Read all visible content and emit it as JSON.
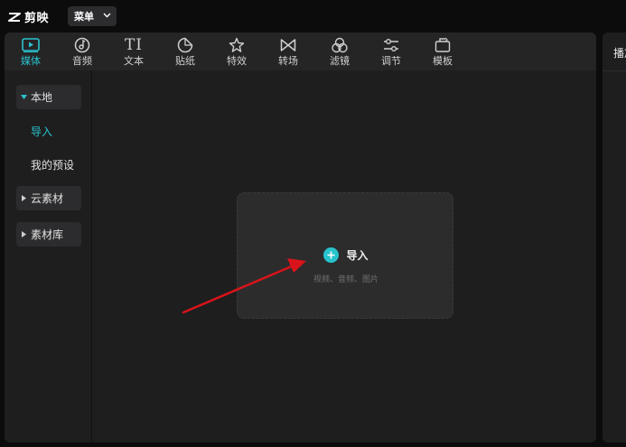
{
  "app": {
    "name": "剪映",
    "menu_label": "菜单"
  },
  "toolbar": {
    "items": [
      {
        "label": "媒体",
        "icon": "media-icon",
        "active": true
      },
      {
        "label": "音频",
        "icon": "audio-icon",
        "active": false
      },
      {
        "label": "文本",
        "icon": "text-icon",
        "active": false
      },
      {
        "label": "贴纸",
        "icon": "sticker-icon",
        "active": false
      },
      {
        "label": "特效",
        "icon": "effects-icon",
        "active": false
      },
      {
        "label": "转场",
        "icon": "transition-icon",
        "active": false
      },
      {
        "label": "滤镜",
        "icon": "filter-icon",
        "active": false
      },
      {
        "label": "调节",
        "icon": "adjust-icon",
        "active": false
      },
      {
        "label": "模板",
        "icon": "template-icon",
        "active": false
      }
    ],
    "text_icon_glyph": "TI"
  },
  "sidebar": {
    "local": "本地",
    "import": "导入",
    "presets": "我的预设",
    "cloud": "云素材",
    "library": "素材库"
  },
  "dropzone": {
    "label": "导入",
    "hint": "视频、音频、图片"
  },
  "player": {
    "title": "播放器"
  },
  "colors": {
    "accent": "#28c4cf",
    "annotation_arrow": "#d8141a",
    "panel_bg": "#1e1e1f",
    "app_bg": "#0c0c0d"
  }
}
